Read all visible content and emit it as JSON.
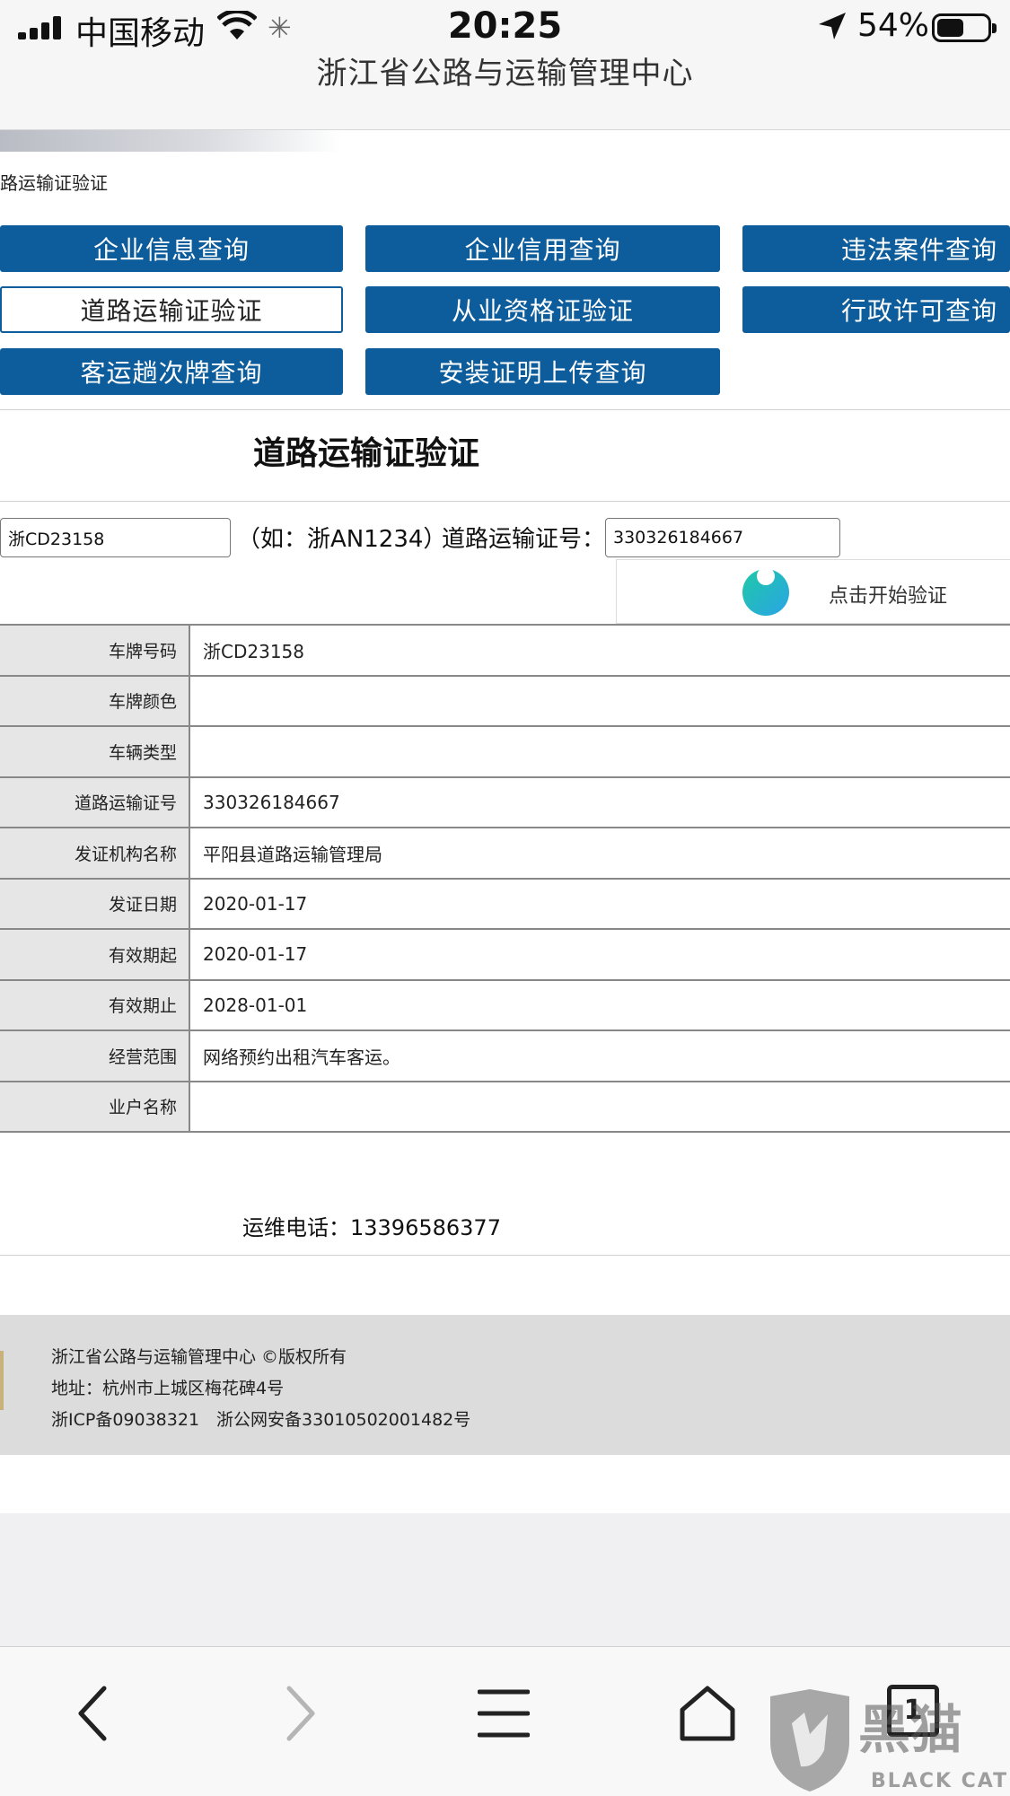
{
  "status_bar": {
    "carrier": "中国移动",
    "time": "20:25",
    "battery": "54%",
    "battery_level": 0.54
  },
  "browser": {
    "title": "浙江省公路与运输管理中心"
  },
  "breadcrumb": "路运输证验证",
  "nav": {
    "row1": [
      "企业信息查询",
      "企业信用查询",
      "违法案件查询"
    ],
    "row2": [
      "道路运输证验证",
      "从业资格证验证",
      "行政许可查询"
    ],
    "row3": [
      "客运趟次牌查询",
      "安装证明上传查询"
    ],
    "active": "道路运输证验证"
  },
  "form": {
    "title": "道路运输证验证",
    "plate_value": "浙CD23158",
    "plate_hint": "（如：浙AN1234）",
    "cert_label": "道路运输证号：",
    "cert_value": "330326184667",
    "verify_label": "点击开始验证"
  },
  "result": {
    "rows": [
      {
        "label": "车牌号码",
        "value": "浙CD23158"
      },
      {
        "label": "车牌颜色",
        "value": ""
      },
      {
        "label": "车辆类型",
        "value": ""
      },
      {
        "label": "道路运输证号",
        "value": "330326184667"
      },
      {
        "label": "发证机构名称",
        "value": "平阳县道路运输管理局"
      },
      {
        "label": "发证日期",
        "value": "2020-01-17"
      },
      {
        "label": "有效期起",
        "value": "2020-01-17"
      },
      {
        "label": "有效期止",
        "value": "2028-01-01"
      },
      {
        "label": "经营范围",
        "value": "网络预约出租汽车客运。"
      },
      {
        "label": "业户名称",
        "value": ""
      }
    ]
  },
  "ops_phone": "运维电话：13396586377",
  "footer": {
    "line1": "浙江省公路与运输管理中心 ©版权所有",
    "line2": "地址：杭州市上城区梅花碑4号",
    "line3": "浙ICP备09038321　浙公网安备33010502001482号"
  },
  "toolbar": {
    "icons": [
      "back-icon",
      "forward-icon",
      "menu-icon",
      "home-icon",
      "tabs-icon"
    ],
    "tabs_count": "1"
  },
  "watermark": {
    "text": "黑猫",
    "sub": "BLACK CAT"
  },
  "colors": {
    "nav_blue": "#0d5c9b",
    "table_label_bg": "#e6e6e6",
    "footer_bg": "#dcdcdc"
  }
}
